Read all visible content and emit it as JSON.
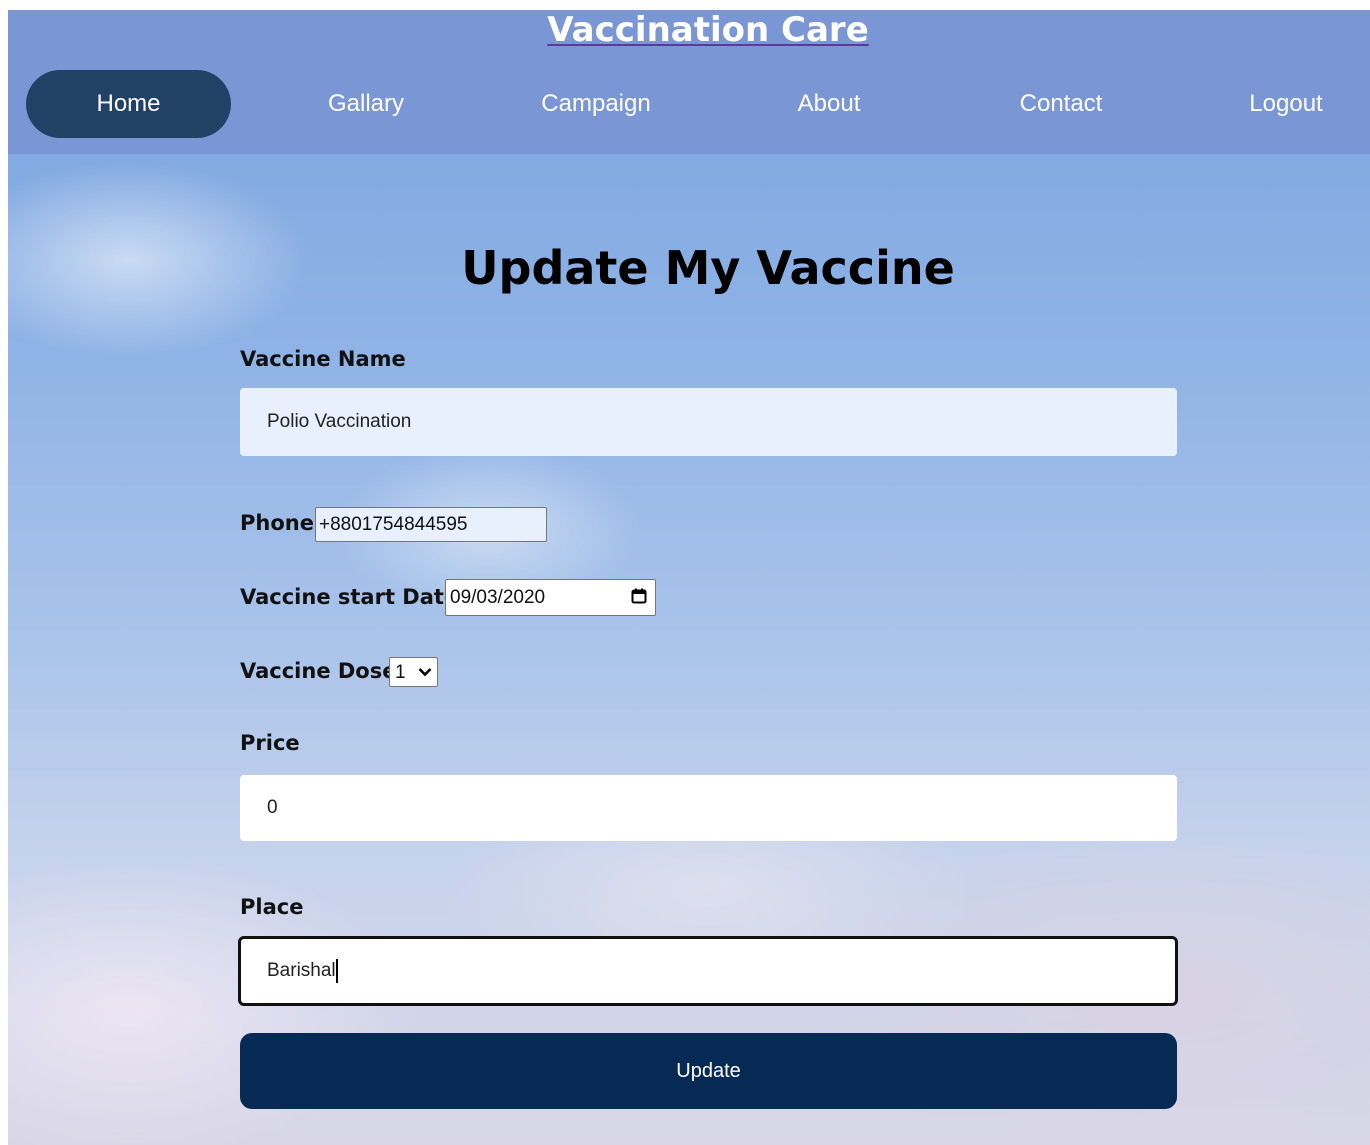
{
  "header": {
    "brand": "Vaccination Care",
    "nav": [
      {
        "label": "Home",
        "active": true
      },
      {
        "label": "Gallary",
        "active": false
      },
      {
        "label": "Campaign",
        "active": false
      },
      {
        "label": "About",
        "active": false
      },
      {
        "label": "Contact",
        "active": false
      },
      {
        "label": "Logout",
        "active": false
      }
    ]
  },
  "form": {
    "title": "Update My Vaccine",
    "vaccine_name": {
      "label": "Vaccine Name",
      "value": "Polio Vaccination"
    },
    "phone": {
      "label": "Phone",
      "value": "+8801754844595"
    },
    "start_date": {
      "label": "Vaccine start Date",
      "value": "09/03/2020",
      "icon": "calendar-icon"
    },
    "dose": {
      "label": "Vaccine Dose",
      "value": "1",
      "icon": "chevron-down-icon"
    },
    "price": {
      "label": "Price",
      "value": "0"
    },
    "place": {
      "label": "Place",
      "value": "Barishal"
    },
    "submit_label": "Update"
  },
  "colors": {
    "header_bg": "#7a96d4",
    "nav_active_bg": "#214264",
    "button_bg": "#072a55",
    "vaccine_name_bg": "#e8f0fe"
  }
}
